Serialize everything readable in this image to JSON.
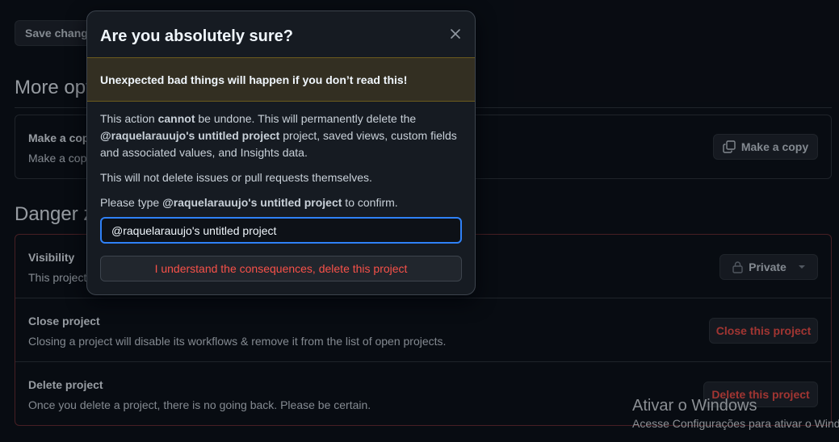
{
  "background": {
    "save_button": "Save changes",
    "more_options_title": "More options",
    "copy_row": {
      "title": "Make a copy",
      "desc": "Make a copy of this project",
      "button": "Make a copy"
    },
    "danger_title": "Danger zone",
    "visibility_row": {
      "title": "Visibility",
      "desc": "This project is currently private.",
      "button": "Private"
    },
    "close_row": {
      "title": "Close project",
      "desc": "Closing a project will disable its workflows & remove it from the list of open projects.",
      "button": "Close this project"
    },
    "delete_row": {
      "title": "Delete project",
      "desc": "Once you delete a project, there is no going back. Please be certain.",
      "button": "Delete this project"
    }
  },
  "dialog": {
    "title": "Are you absolutely sure?",
    "warning": "Unexpected bad things will happen if you don’t read this!",
    "p1_a": "This action ",
    "p1_b": "cannot",
    "p1_c": " be undone. This will permanently delete the ",
    "p1_d": "@raquelarauujo's untitled project",
    "p1_e": " project, saved views, custom fields and associated values, and Insights data.",
    "p2": "This will not delete issues or pull requests themselves.",
    "p3_a": "Please type ",
    "p3_b": "@raquelarauujo's untitled project",
    "p3_c": " to confirm.",
    "input_value": "@raquelarauujo's untitled project",
    "confirm_button": "I understand the consequences, delete this project"
  },
  "watermark": {
    "line1": "Ativar o Windows",
    "line2": "Acesse Configurações para ativar o Windows."
  },
  "icons": {
    "close": "close-icon",
    "copy": "copy-icon",
    "lock": "lock-icon",
    "caret": "caret-down-icon"
  },
  "colors": {
    "background": "#0d1117",
    "danger": "#f85149",
    "accent_focus": "#2f81f7",
    "warning_bg": "#332f22"
  }
}
